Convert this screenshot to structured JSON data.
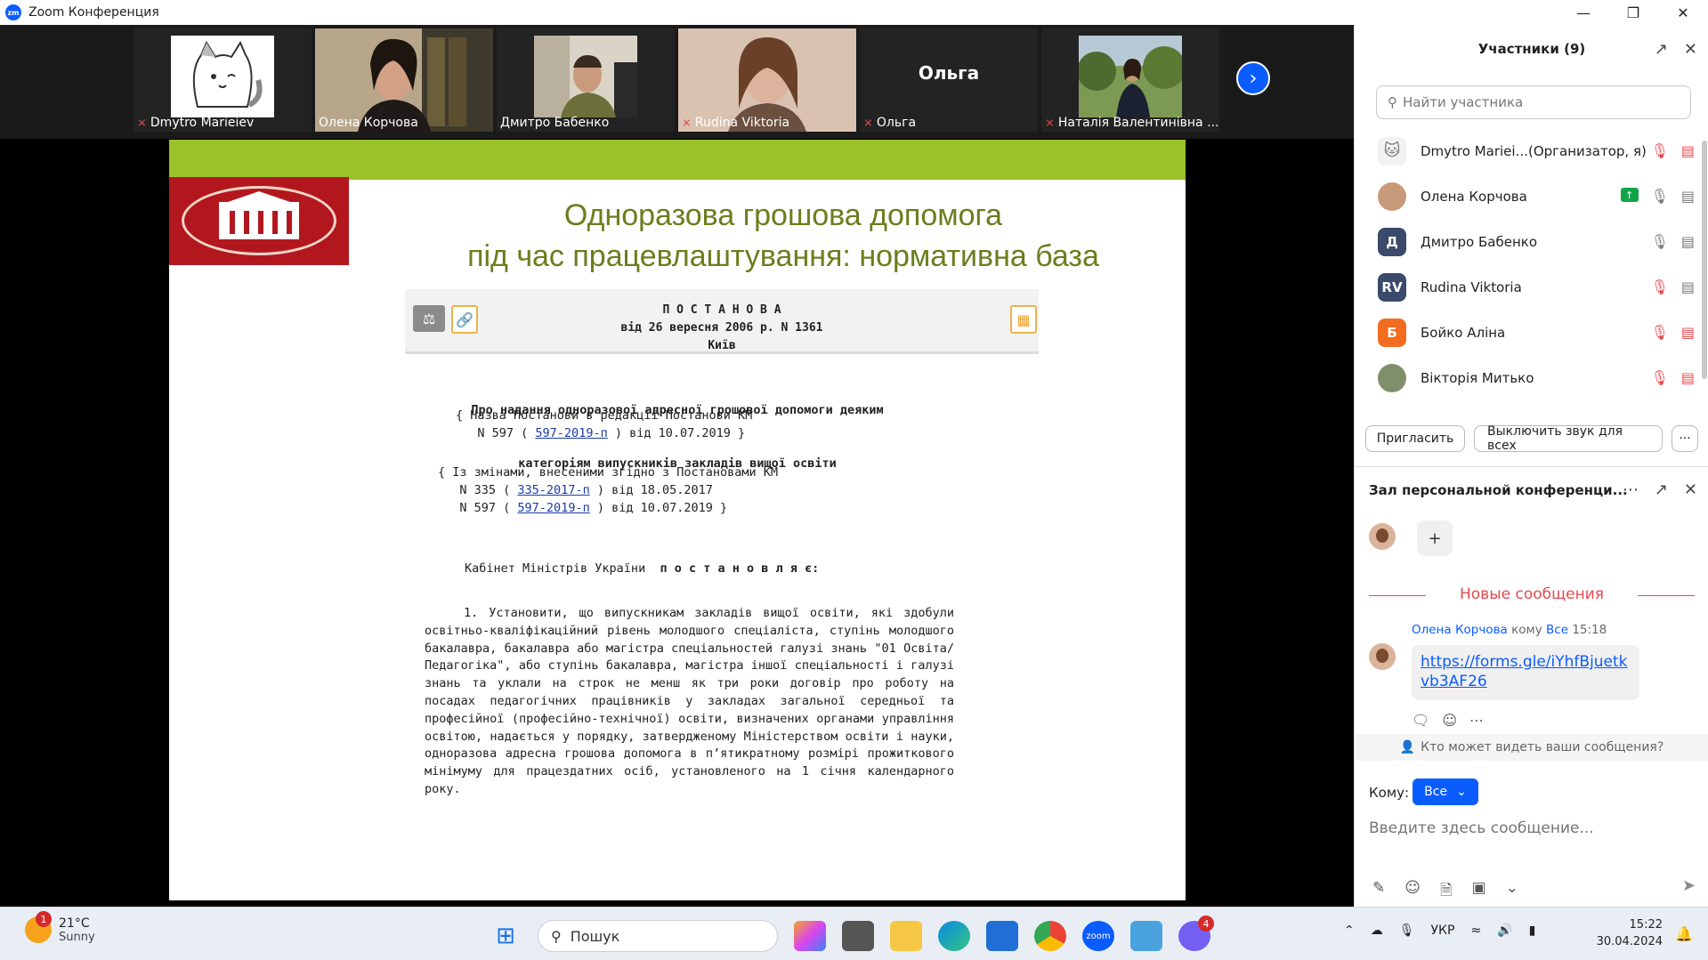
{
  "window": {
    "title": "Zoom Конференция"
  },
  "gallery": {
    "thumbs": [
      {
        "name": "Dmytro Marieiev",
        "muted": true
      },
      {
        "name": "Олена Корчова",
        "muted": false
      },
      {
        "name": "Дмитро Бабенко",
        "muted": false
      },
      {
        "name": "Rudina Viktoria",
        "muted": true
      },
      {
        "name": "Ольга",
        "muted": true,
        "big_label": "Ольга"
      },
      {
        "name": "Наталія Валентинівна ...",
        "muted": true
      }
    ]
  },
  "slide": {
    "title_line1": "Одноразова грошова допомога",
    "title_line2": "під час працевлаштування: нормативна база",
    "doc_header": {
      "line1": "П О С Т А Н О В А",
      "line2": "від 26 вересня 2006 р. N 1361",
      "line3": "Київ"
    },
    "doc_title_line1": "Про надання одноразової адресної грошової допомоги деяким",
    "doc_title_line2": "категоріям випускників закладів вищої освіти",
    "note1_a": "{ Назва Постанови в редакції Постанови КМ",
    "note1_b": "N 597 ( ",
    "note1_link": "597-2019-п",
    "note1_c": " ) від 10.07.2019 }",
    "note2_a": "{ Із змінами, внесеними згідно з Постановами КМ",
    "note2_b1": "N 335 ( ",
    "note2_link1": "335-2017-п",
    "note2_c1": " ) від 18.05.2017",
    "note2_b2": "N 597 ( ",
    "note2_link2": "597-2019-п",
    "note2_c2": " ) від 10.07.2019 }",
    "cabinet_a": "Кабінет Міністрів України",
    "cabinet_b": "п о с т а н о в л я є:",
    "paragraph": "1. Установити, що випускникам закладів вищої освіти, які здобули освітньо-кваліфікаційний рівень молодшого спеціаліста, ступінь молодшого бакалавра, бакалавра або магістра спеціальностей галузі знань \"01 Освіта/Педагогіка\", або ступінь бакалавра, магістра іншої спеціальності і галузі знань та уклали на строк не менш як три роки договір про роботу на посадах педагогічних працівників у закладах загальної середньої та професійної (професійно-технічної) освіти, визначених органами управління освітою, надається у порядку, затвердженому Міністерством освіти і науки, одноразова адресна грошова допомога в п’ятикратному розмірі прожиткового мінімуму для працездатних осіб, установленого на 1 січня календарного року."
  },
  "participants": {
    "header": "Участники (9)",
    "search_placeholder": "Найти участника",
    "list": [
      {
        "name": "Dmytro Mariei...",
        "role": "(Организатор, я)",
        "avatar": "",
        "avatar_color": "#e8e8e8"
      },
      {
        "name": "Олена Корчова",
        "role": "",
        "avatar": "",
        "avatar_color": "#c89a7a"
      },
      {
        "name": "Дмитро Бабенко",
        "role": "",
        "avatar": "Д",
        "avatar_color": "#3b4a6b"
      },
      {
        "name": "Rudina Viktoria",
        "role": "",
        "avatar": "RV",
        "avatar_color": "#3b4a6b"
      },
      {
        "name": "Бойко Аліна",
        "role": "",
        "avatar": "Б",
        "avatar_color": "#f26d21"
      },
      {
        "name": "Вікторія Митько",
        "role": "",
        "avatar": "",
        "avatar_color": "#7f8f6a"
      }
    ],
    "invite_label": "Пригласить",
    "mute_all_label": "Выключить звук для всех",
    "more_label": "···"
  },
  "chat": {
    "header": "Зал персональной конференци...",
    "new_messages": "Новые сообщения",
    "sender": "Олена Корчова",
    "to_word": "кому",
    "to_target": "Все",
    "time": "15:18",
    "message": "https://forms.gle/iYhfBjuetkvb3AF26",
    "who_sees": "Кто может видеть ваши сообщения?",
    "to_label": "Кому:",
    "to_value": "Все",
    "input_placeholder": "Введите здесь сообщение...",
    "add_reaction": "+"
  },
  "taskbar": {
    "temperature": "21°C",
    "condition": "Sunny",
    "weather_badge": "1",
    "search_label": "Пошук",
    "viber_badge": "4",
    "language": "УКР",
    "time": "15:22",
    "date": "30.04.2024"
  }
}
